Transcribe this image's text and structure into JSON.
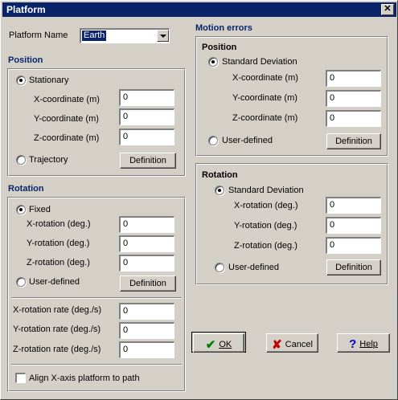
{
  "window": {
    "title": "Platform",
    "close_glyph": "✕"
  },
  "platform_name": {
    "label": "Platform Name",
    "value": "Earth"
  },
  "position": {
    "section_title": "Position",
    "stationary_label": "Stationary",
    "x_label": "X-coordinate (m)",
    "x_value": "0",
    "y_label": "Y-coordinate (m)",
    "y_value": "0",
    "z_label": "Z-coordinate (m)",
    "z_value": "0",
    "trajectory_label": "Trajectory",
    "definition_button": "Definition"
  },
  "rotation": {
    "section_title": "Rotation",
    "fixed_label": "Fixed",
    "x_label": "X-rotation (deg.)",
    "x_value": "0",
    "y_label": "Y-rotation (deg.)",
    "y_value": "0",
    "z_label": "Z-rotation (deg.)",
    "z_value": "0",
    "user_defined_label": "User-defined",
    "definition_button": "Definition",
    "x_rate_label": "X-rotation rate (deg./s)",
    "x_rate_value": "0",
    "y_rate_label": "Y-rotation rate (deg./s)",
    "y_rate_value": "0",
    "z_rate_label": "Z-rotation rate (deg./s)",
    "z_rate_value": "0",
    "align_label": "Align X-axis platform to path"
  },
  "motion_errors": {
    "section_title": "Motion errors",
    "position": {
      "title": "Position",
      "std_label": "Standard Deviation",
      "x_label": "X-coordinate (m)",
      "x_value": "0",
      "y_label": "Y-coordinate (m)",
      "y_value": "0",
      "z_label": "Z-coordinate (m)",
      "z_value": "0",
      "user_defined_label": "User-defined",
      "definition_button": "Definition"
    },
    "rotation": {
      "title": "Rotation",
      "std_label": "Standard Deviation",
      "x_label": "X-rotation (deg.)",
      "x_value": "0",
      "y_label": "Y-rotation (deg.)",
      "y_value": "0",
      "z_label": "Z-rotation (deg.)",
      "z_value": "0",
      "user_defined_label": "User-defined",
      "definition_button": "Definition"
    }
  },
  "buttons": {
    "ok": "OK",
    "ok_glyph": "✔",
    "ok_color": "#008000",
    "cancel": "Cancel",
    "cancel_glyph": "✘",
    "cancel_color": "#c00000",
    "help": "Help",
    "help_glyph": "?",
    "help_color": "#0000c0"
  },
  "colors": {
    "titlebar": "#0a246a",
    "section_heading": "#0a246a",
    "face": "#d4d0c8"
  }
}
